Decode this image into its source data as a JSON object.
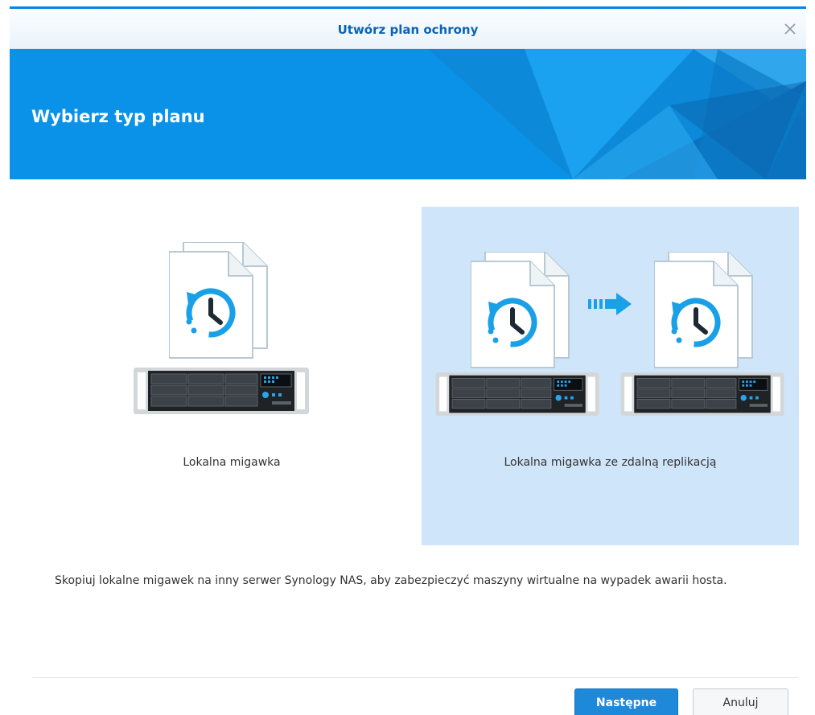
{
  "window": {
    "title": "Utwórz plan ochrony",
    "close_icon": "close-icon"
  },
  "banner": {
    "title": "Wybierz typ planu"
  },
  "options": [
    {
      "label": "Lokalna migawka",
      "selected": false,
      "icons": [
        "document-snapshot-icon",
        "nas-server-icon"
      ]
    },
    {
      "label": "Lokalna migawka ze zdalną replikacją",
      "selected": true,
      "icons": [
        "document-snapshot-icon",
        "replication-arrow-icon",
        "document-snapshot-icon",
        "nas-server-icon",
        "nas-server-icon"
      ]
    }
  ],
  "description": "Skopiuj lokalne migawek na inny serwer Synology NAS, aby zabezpieczyć maszyny wirtualne na wypadek awarii hosta.",
  "buttons": {
    "next": "Następne",
    "cancel": "Anuluj"
  },
  "colors": {
    "accent": "#0086e5",
    "banner": "#0a90e6",
    "selected_bg": "#cfe6fa",
    "primary_button": "#1e88d9",
    "icon_blue": "#1aa0e6"
  }
}
